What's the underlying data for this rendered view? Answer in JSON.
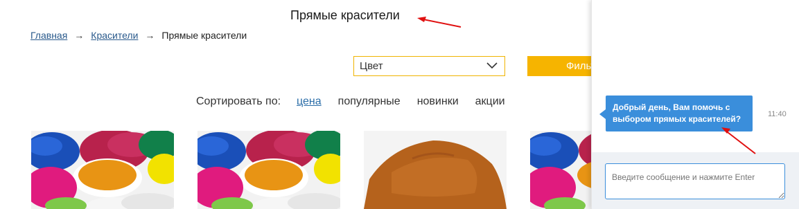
{
  "page": {
    "title": "Прямые красители"
  },
  "breadcrumb": {
    "home": "Главная",
    "sep1": "→",
    "dyes": "Красители",
    "sep2": "→",
    "current": "Прямые красители"
  },
  "filters": {
    "color_value": "Цвет",
    "filter_button": "Фильтр"
  },
  "sort": {
    "label": "Сортировать по:",
    "options": [
      "цена",
      "популярные",
      "новинки",
      "акции"
    ]
  },
  "chat": {
    "message": "Добрый день, Вам помочь с выбором прямых красителей?",
    "time": "11:40",
    "input_placeholder": "Введите сообщение и нажмите Enter"
  },
  "colors": {
    "accent": "#f6b400",
    "link": "#2a5a8c",
    "chat_blue": "#3a8edb",
    "annotation": "#e01010"
  },
  "icons": {
    "select": "chevron-down-icon"
  }
}
